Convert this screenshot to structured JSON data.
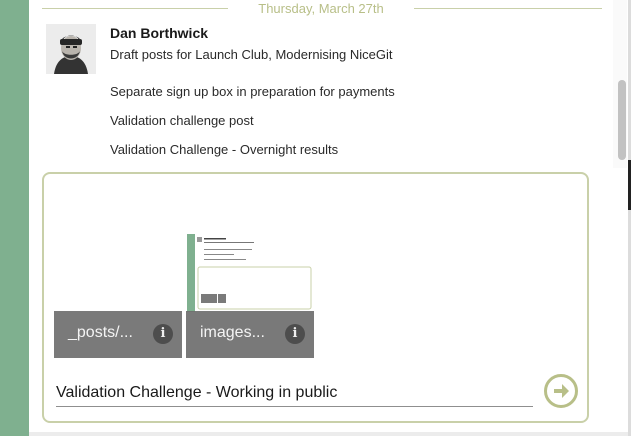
{
  "date_divider": {
    "label": "Thursday, March 27th"
  },
  "message": {
    "author": "Dan Borthwick",
    "lines": [
      "Draft posts for Launch Club, Modernising NiceGit",
      "Separate sign up box in preparation for payments",
      "Validation challenge post",
      "Validation Challenge - Overnight results"
    ]
  },
  "composer": {
    "attachments": [
      {
        "name": "_posts/...",
        "info_icon": "i"
      },
      {
        "name": "images...",
        "info_icon": "i"
      }
    ],
    "input_value": "Validation Challenge - Working in public",
    "send_icon": "arrow-right-circle-icon"
  },
  "colors": {
    "accent_olive": "#b8bf88",
    "border_olive": "#c9d0a9",
    "sidebar_green": "#7fb08f",
    "tile_gray": "#7a7a7a"
  }
}
